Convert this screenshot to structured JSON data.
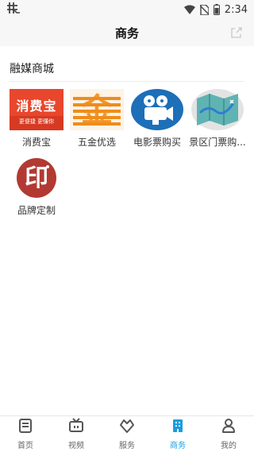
{
  "status": {
    "time": "2:34",
    "app_icon": "hashtag-tree-icon",
    "icons": [
      "wifi-icon",
      "no-sim-icon",
      "battery-icon"
    ]
  },
  "header": {
    "title": "商务",
    "share_icon": "share-icon"
  },
  "section": {
    "title": "融媒商城"
  },
  "apps": [
    {
      "label": "消费宝",
      "logo_text": "消费宝",
      "logo_sub": "更便捷 更懂你"
    },
    {
      "label": "五金优选",
      "logo_char": "金"
    },
    {
      "label": "电影票购买"
    },
    {
      "label": "景区门票购..."
    },
    {
      "label": "品牌定制",
      "logo_char": "印"
    }
  ],
  "nav": {
    "items": [
      {
        "label": "首页",
        "icon": "news-icon"
      },
      {
        "label": "视频",
        "icon": "tv-icon"
      },
      {
        "label": "服务",
        "icon": "heart-diamond-icon"
      },
      {
        "label": "商务",
        "icon": "building-icon"
      },
      {
        "label": "我的",
        "icon": "person-icon"
      }
    ],
    "active": "商务"
  },
  "colors": {
    "accent": "#1a9de0",
    "red": "#e8472d",
    "orange": "#f08c1a",
    "seal_red": "#b23a32"
  }
}
